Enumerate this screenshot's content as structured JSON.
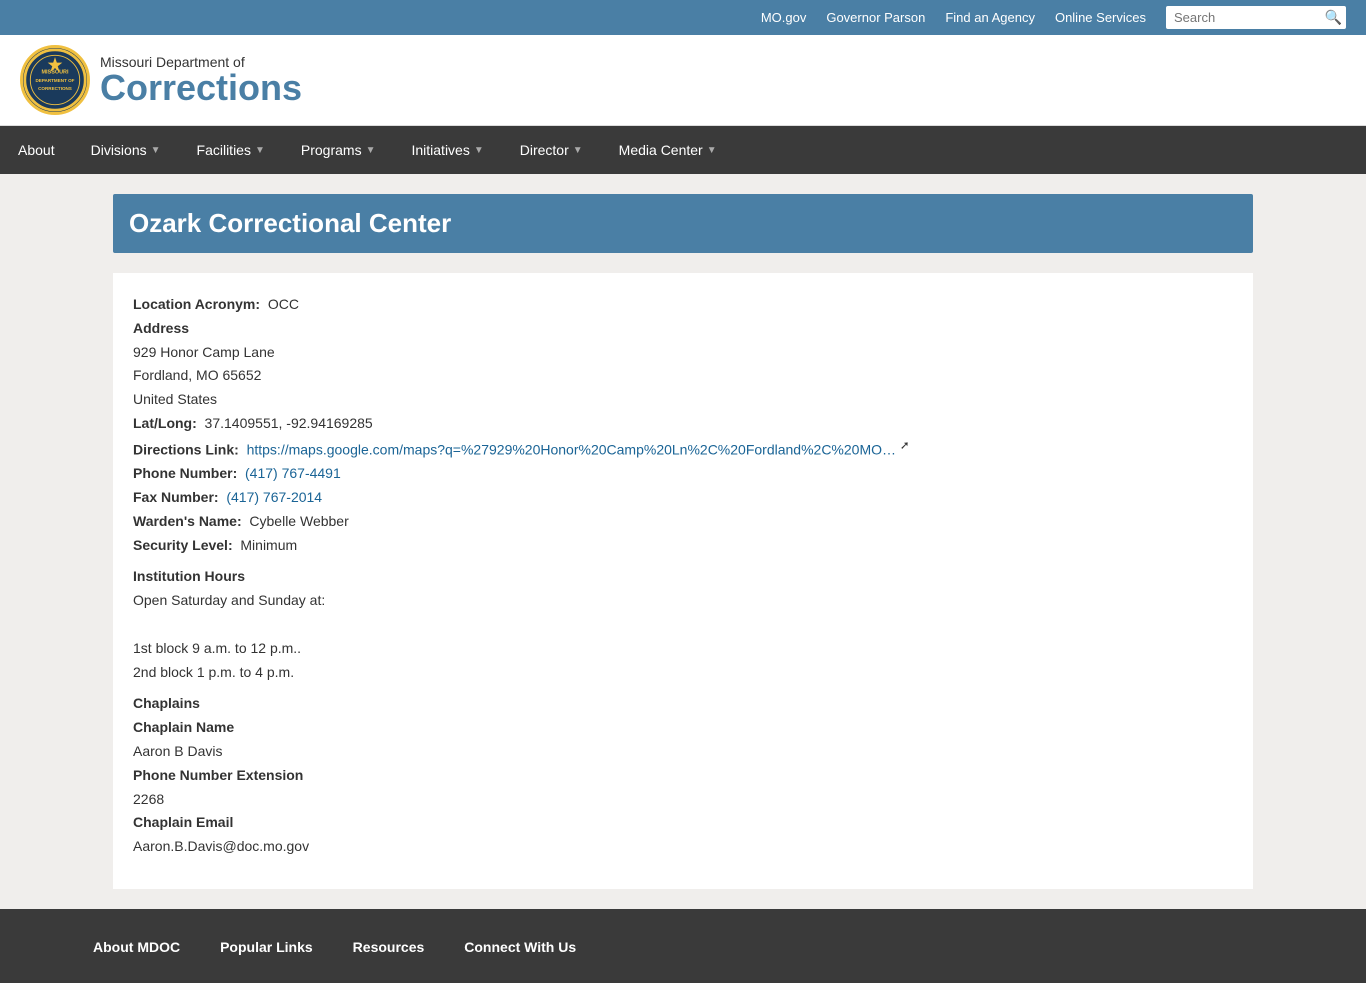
{
  "topbar": {
    "links": [
      {
        "label": "MO.gov",
        "name": "mo-gov-link"
      },
      {
        "label": "Governor Parson",
        "name": "governor-link"
      },
      {
        "label": "Find an Agency",
        "name": "find-agency-link"
      },
      {
        "label": "Online Services",
        "name": "online-services-link"
      }
    ],
    "search_placeholder": "Search"
  },
  "header": {
    "dept_line1": "Missouri Department of",
    "dept_line2": "Corrections",
    "seal_text": "MISSOURI\nDEPT OF\nCORRECTIONS"
  },
  "nav": {
    "items": [
      {
        "label": "About",
        "has_caret": false
      },
      {
        "label": "Divisions",
        "has_caret": true
      },
      {
        "label": "Facilities",
        "has_caret": true
      },
      {
        "label": "Programs",
        "has_caret": true
      },
      {
        "label": "Initiatives",
        "has_caret": true
      },
      {
        "label": "Director",
        "has_caret": true
      },
      {
        "label": "Media Center",
        "has_caret": true
      }
    ]
  },
  "page": {
    "title": "Ozark Correctional Center",
    "location_acronym_label": "Location Acronym:",
    "location_acronym_value": "OCC",
    "address_label": "Address",
    "address_line1": "929 Honor Camp Lane",
    "address_line2": "Fordland, MO 65652",
    "address_line3": "United States",
    "lat_long_label": "Lat/Long:",
    "lat_long_value": "37.1409551, -92.94169285",
    "directions_label": "Directions Link:",
    "directions_url": "https://maps.google.com/maps?q=%27929%20Honor%20Camp%20Ln%2C%20Fordland%2C%20MO...",
    "directions_display": "https://maps.google.com/maps?q=%27929%20Honor%20Camp%20Ln%2C%20Fordland%2C%20MO…",
    "phone_label": "Phone Number:",
    "phone_value": "(417) 767-4491",
    "fax_label": "Fax Number:",
    "fax_value": "(417) 767-2014",
    "warden_label": "Warden's Name:",
    "warden_value": "Cybelle Webber",
    "security_label": "Security Level:",
    "security_value": "Minimum",
    "institution_hours_heading": "Institution Hours",
    "institution_hours_text": "Open Saturday and Sunday at:",
    "block1": "1st block 9 a.m. to 12 p.m..",
    "block2": "2nd block 1 p.m. to 4 p.m.",
    "chaplains_heading": "Chaplains",
    "chaplain_name_label": "Chaplain Name",
    "chaplain_name_value": "Aaron B Davis",
    "phone_ext_label": "Phone Number Extension",
    "phone_ext_value": "2268",
    "chaplain_email_label": "Chaplain Email",
    "chaplain_email_value": "Aaron.B.Davis@doc.mo.gov"
  },
  "footer": {
    "col1_heading": "About MDOC",
    "col2_heading": "Popular Links",
    "col3_heading": "Resources",
    "col4_heading": "Connect With Us"
  }
}
